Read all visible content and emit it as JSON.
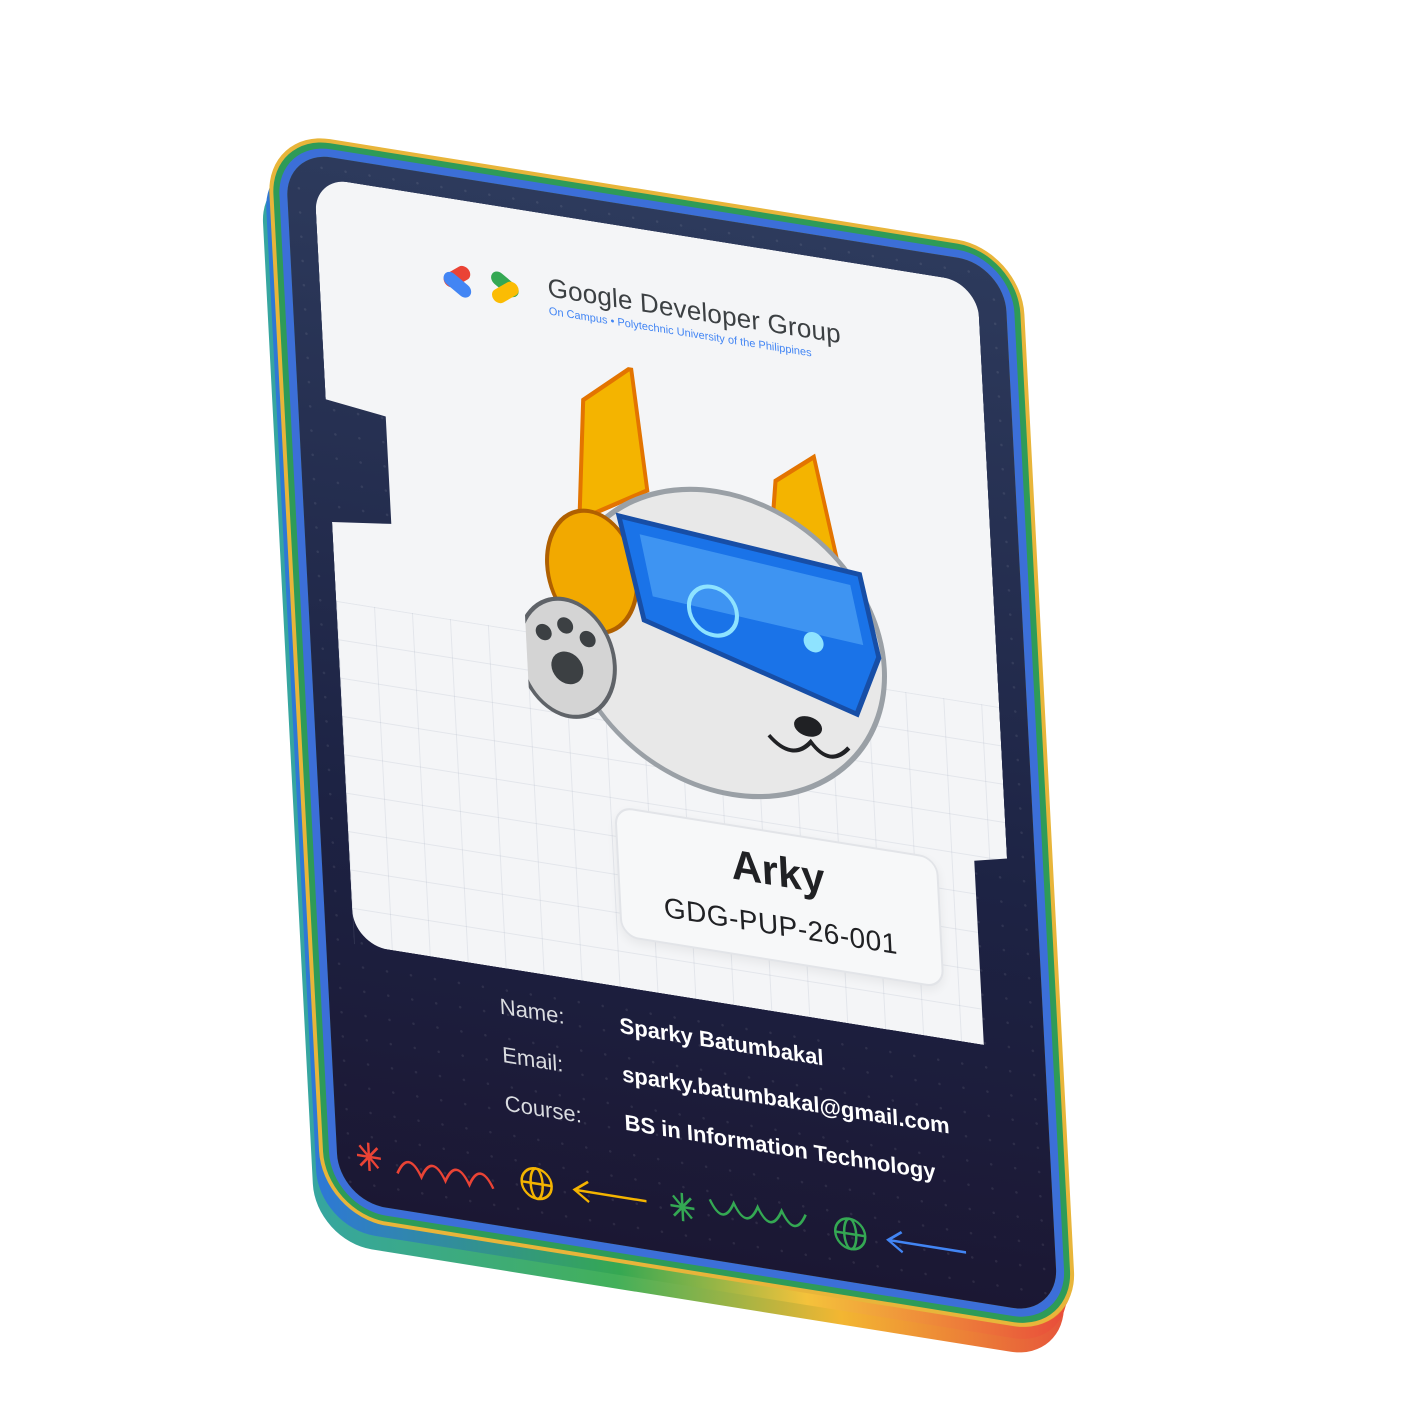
{
  "brand": {
    "name": "Google Developer Group",
    "subtitle": "On Campus • Polytechnic University of the Philippines",
    "colors": {
      "blue": "#4285f4",
      "red": "#ea4335",
      "yellow": "#fbbc04",
      "green": "#34a853"
    }
  },
  "avatar": {
    "name": "Arky",
    "id": "GDG-PUP-26-001"
  },
  "details": {
    "name_label": "Name:",
    "name_value": "Sparky Batumbakal",
    "email_label": "Email:",
    "email_value": "sparky.batumbakal@gmail.com",
    "course_label": "Course:",
    "course_value": "BS in Information Technology"
  },
  "decoration_icons": [
    "asterisk-icon",
    "wave-icon",
    "globe-icon",
    "arrow-left-icon",
    "asterisk-icon",
    "wave-icon",
    "globe-icon",
    "arrow-left-icon"
  ]
}
